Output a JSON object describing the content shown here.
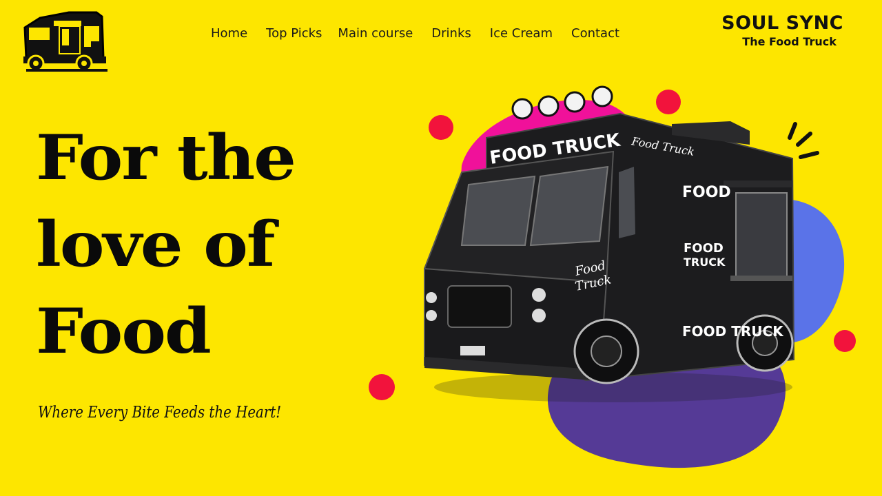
{
  "nav": {
    "items": [
      {
        "label": "Home"
      },
      {
        "label": "Top Picks"
      },
      {
        "label": "Main course"
      },
      {
        "label": "Drinks"
      },
      {
        "label": "Ice Cream"
      },
      {
        "label": "Contact"
      }
    ]
  },
  "brand": {
    "name": "SOUL SYNC",
    "tagline": "The Food Truck"
  },
  "hero": {
    "title_lines": [
      "For the",
      "love of",
      "Food"
    ],
    "subtitle": "Where Every Bite Feeds the Heart!"
  },
  "truck": {
    "front_sign": "FOOD TRUCK",
    "top_script": "Food Truck",
    "side_food": "FOOD",
    "side_food_truck_line1": "FOOD",
    "side_food_truck_line2": "TRUCK",
    "door_script_line1": "Food",
    "door_script_line2": "Truck",
    "bottom_sign": "FOOD TRUCK"
  },
  "colors": {
    "background": "#fde600",
    "accent_red": "#f2133c",
    "blob_magenta": "#f0119a",
    "blob_blue": "#5a73e8",
    "blob_purple": "#553a96",
    "truck_body": "#1c1c1e"
  }
}
